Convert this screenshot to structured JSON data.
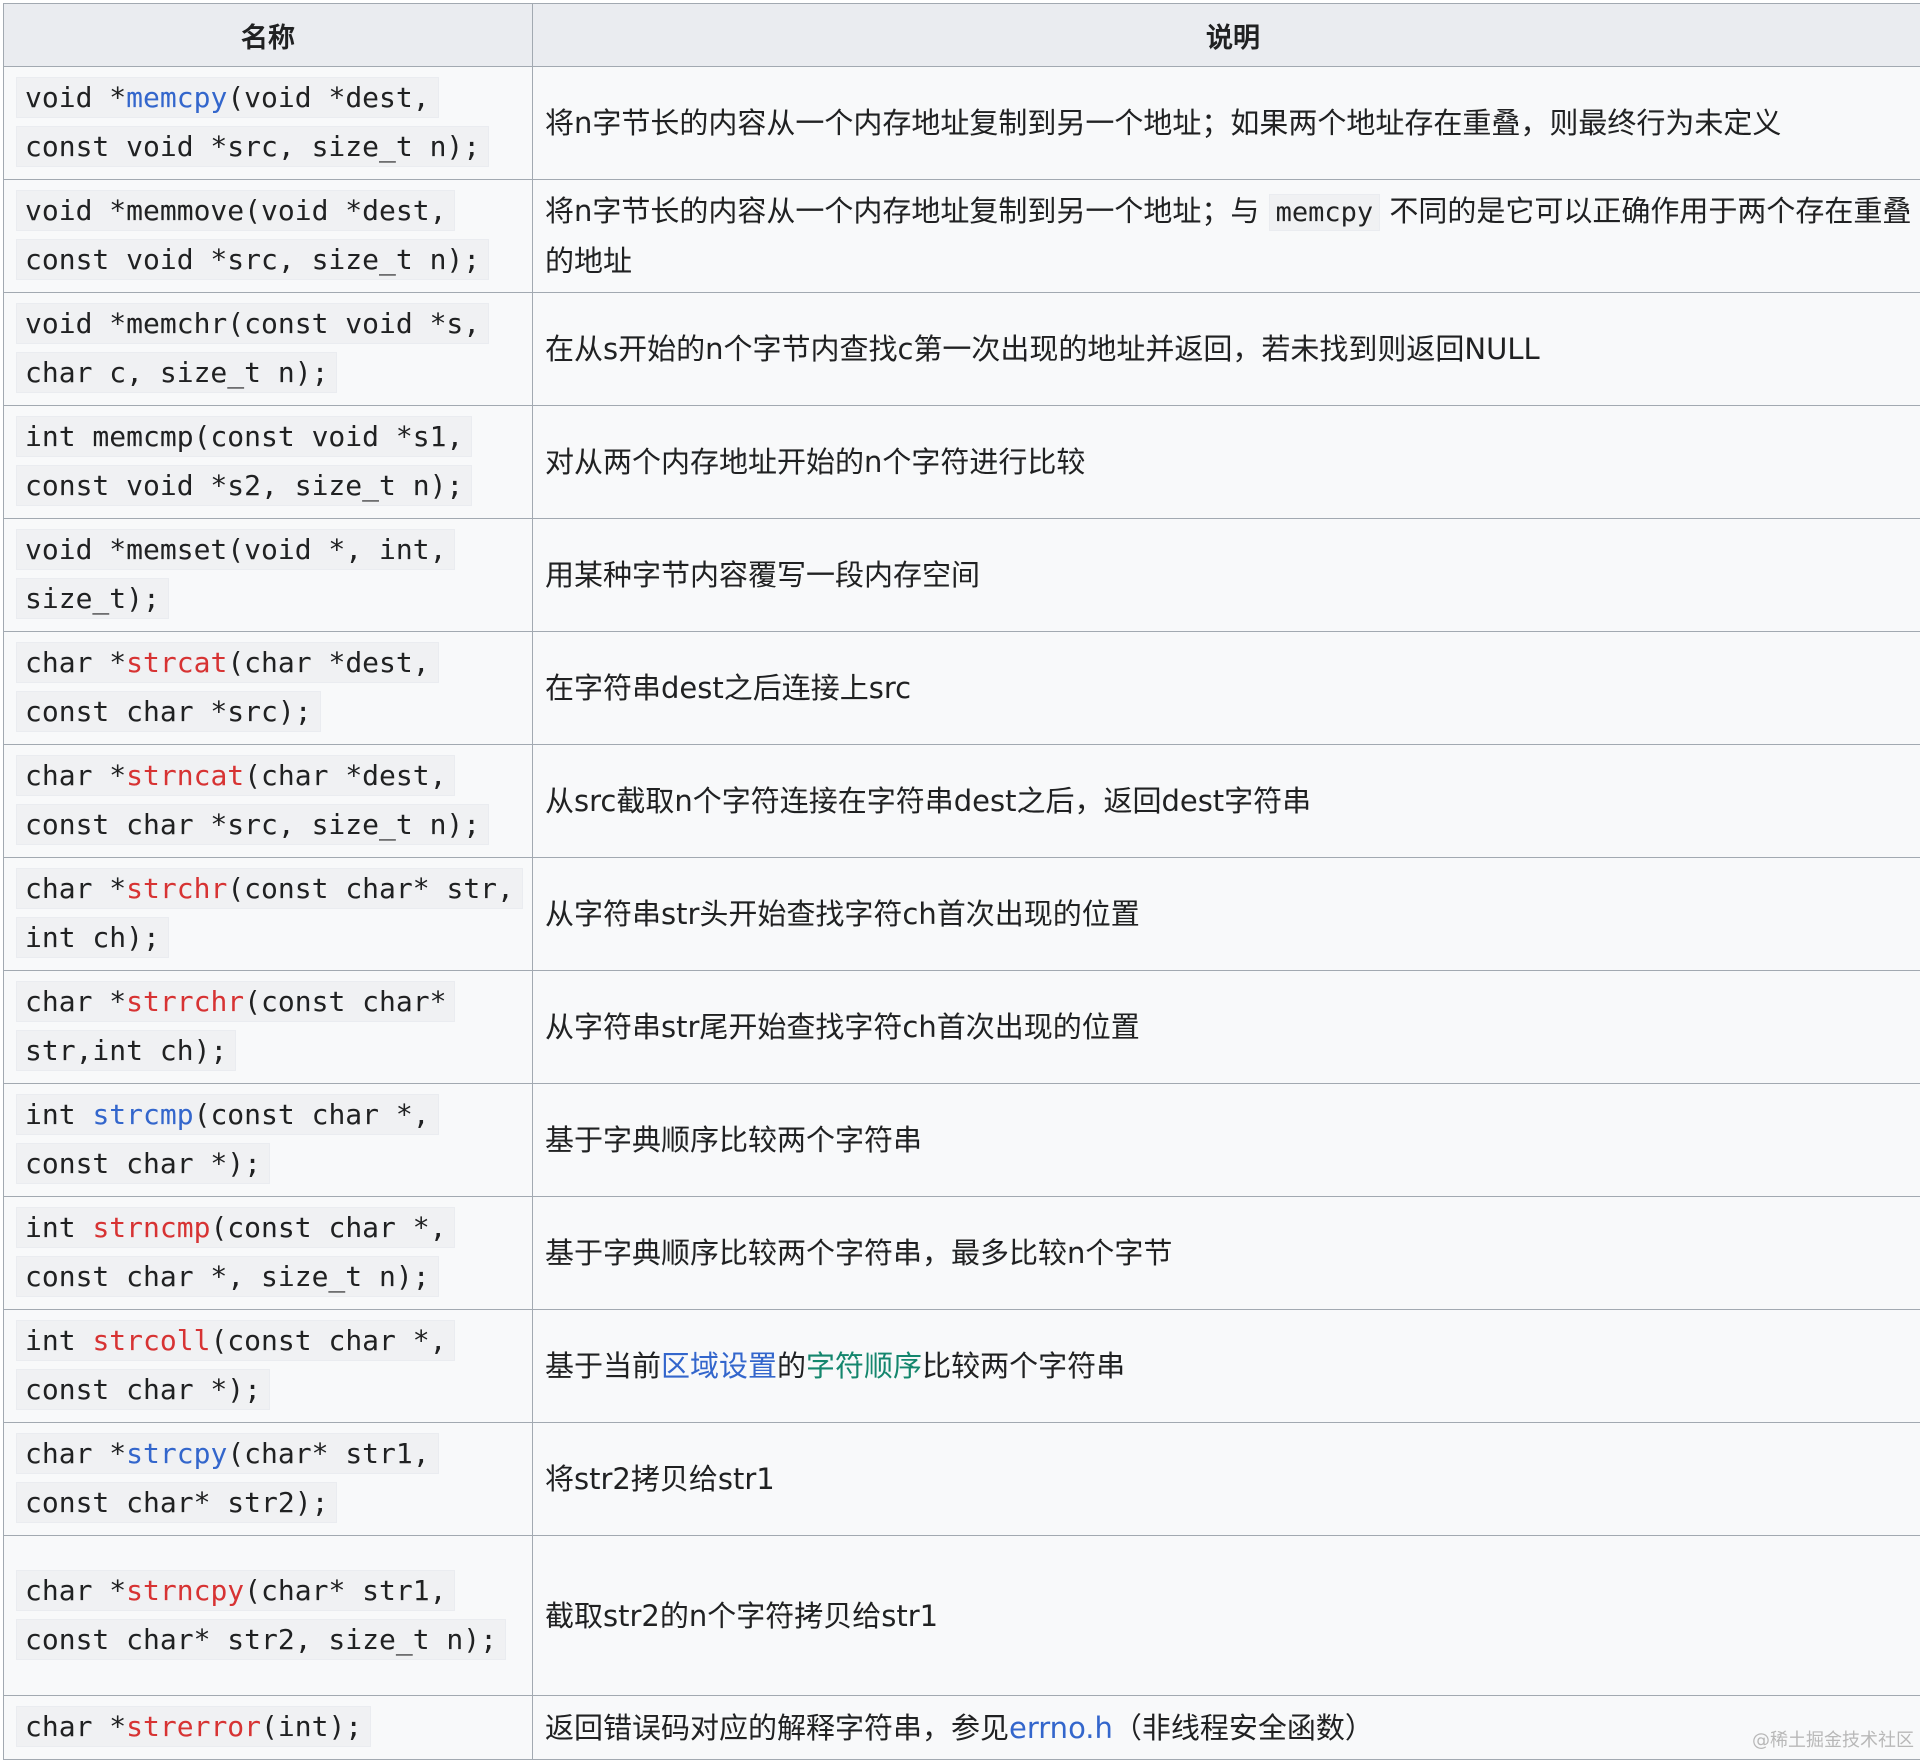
{
  "headers": {
    "name": "名称",
    "desc": "说明"
  },
  "rows": [
    {
      "pre": "void *",
      "fn": "memcpy",
      "fn_color": "blue",
      "post": "(void *dest, const void *src, size_t n);",
      "desc": "将n字节长的内容从一个内存地址复制到另一个地址；如果两个地址存在重叠，则最终行为未定义"
    },
    {
      "pre": "void *memmove(void *dest, const void *src, size_t n);",
      "fn": "",
      "fn_color": "none",
      "post": "",
      "desc_pre": "将n字节长的内容从一个内存地址复制到另一个地址；与 ",
      "desc_code": "memcpy",
      "desc_post": " 不同的是它可以正确作用于两个存在重叠的地址"
    },
    {
      "pre": "void *memchr(const void *s, char c, size_t n);",
      "fn": "",
      "fn_color": "none",
      "post": "",
      "desc": "在从s开始的n个字节内查找c第一次出现的地址并返回，若未找到则返回NULL"
    },
    {
      "pre": "int memcmp(const void *s1, const void *s2, size_t n);",
      "fn": "",
      "fn_color": "none",
      "post": "",
      "desc": "对从两个内存地址开始的n个字符进行比较"
    },
    {
      "pre": "void *memset(void *, int, size_t);",
      "fn": "",
      "fn_color": "none",
      "post": "",
      "desc": "用某种字节内容覆写一段内存空间"
    },
    {
      "pre": "char *",
      "fn": "strcat",
      "fn_color": "red",
      "post": "(char *dest, const char *src);",
      "desc": "在字符串dest之后连接上src"
    },
    {
      "pre": "char *",
      "fn": "strncat",
      "fn_color": "red",
      "post": "(char *dest, const char *src, size_t n);",
      "desc": "从src截取n个字符连接在字符串dest之后，返回dest字符串"
    },
    {
      "pre": "char *",
      "fn": "strchr",
      "fn_color": "red",
      "post": "(const char* str, int ch);",
      "desc": "从字符串str头开始查找字符ch首次出现的位置"
    },
    {
      "pre": "char *",
      "fn": "strrchr",
      "fn_color": "red",
      "post": "(const char* str,int ch);",
      "desc": "从字符串str尾开始查找字符ch首次出现的位置"
    },
    {
      "pre": "int ",
      "fn": "strcmp",
      "fn_color": "blue",
      "post": "(const char *, const char *);",
      "desc": "基于字典顺序比较两个字符串"
    },
    {
      "pre": "int ",
      "fn": "strncmp",
      "fn_color": "red",
      "post": "(const char *, const char *, size_t n);",
      "desc": "基于字典顺序比较两个字符串，最多比较n个字节"
    },
    {
      "pre": "int ",
      "fn": "strcoll",
      "fn_color": "red",
      "post": "(const char *, const char *);",
      "desc_pre": "基于当前",
      "desc_link1": "区域设置",
      "desc_mid": "的",
      "desc_link2": "字符顺序",
      "desc_post": "比较两个字符串"
    },
    {
      "pre": "char *",
      "fn": "strcpy",
      "fn_color": "blue",
      "post": "(char* str1, const char* str2);",
      "desc": "将str2拷贝给str1"
    },
    {
      "pre": "char *",
      "fn": "strncpy",
      "fn_color": "red",
      "post": "(char* str1, const char* str2, size_t n);",
      "desc": "截取str2的n个字符拷贝给str1"
    },
    {
      "pre": "char *",
      "fn": "strerror",
      "fn_color": "red",
      "post": "(int);",
      "desc_pre": "返回错误码对应的解释字符串，参见",
      "desc_link1": "errno.h",
      "desc_post": "（非线程安全函数）"
    }
  ],
  "watermark": "@稀土掘金技术社区"
}
